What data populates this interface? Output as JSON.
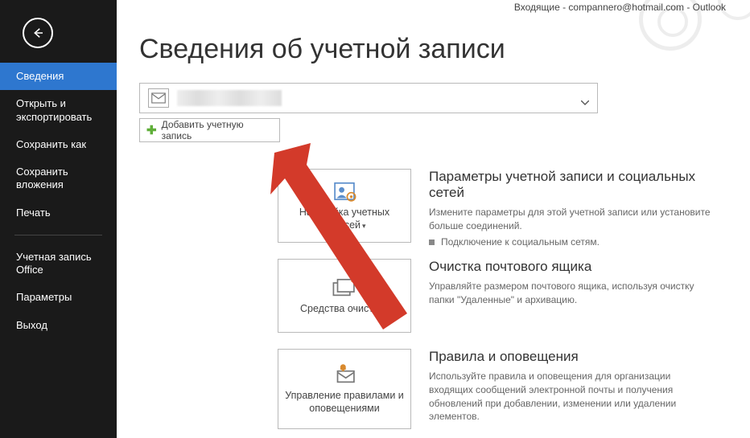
{
  "window": {
    "title": "Входящие - compannero@hotmail.com - Outlook"
  },
  "sidebar": {
    "items": [
      {
        "label": "Сведения",
        "active": true
      },
      {
        "label": "Открыть и экспортировать"
      },
      {
        "label": "Сохранить как"
      },
      {
        "label": "Сохранить вложения"
      },
      {
        "label": "Печать"
      },
      {
        "label": "Учетная запись Office"
      },
      {
        "label": "Параметры"
      },
      {
        "label": "Выход"
      }
    ]
  },
  "page": {
    "heading": "Сведения об учетной записи",
    "add_account": "Добавить учетную запись"
  },
  "tiles": {
    "account_settings": "Настройка учетных записей",
    "cleanup": "Средства очистки",
    "rules": "Управление правилами и оповещениями"
  },
  "sections": {
    "acc": {
      "title": "Параметры учетной записи и социальных сетей",
      "desc": "Измените параметры для этой учетной записи или установите больше соединений.",
      "bullet": "Подключение к социальным сетям."
    },
    "cleanup": {
      "title": "Очистка почтового ящика",
      "desc": "Управляйте размером почтового ящика, используя очистку папки \"Удаленные\" и архивацию."
    },
    "rules": {
      "title": "Правила и оповещения",
      "desc": "Используйте правила и оповещения для организации входящих сообщений электронной почты и получения обновлений при добавлении, изменении или удалении элементов."
    }
  }
}
